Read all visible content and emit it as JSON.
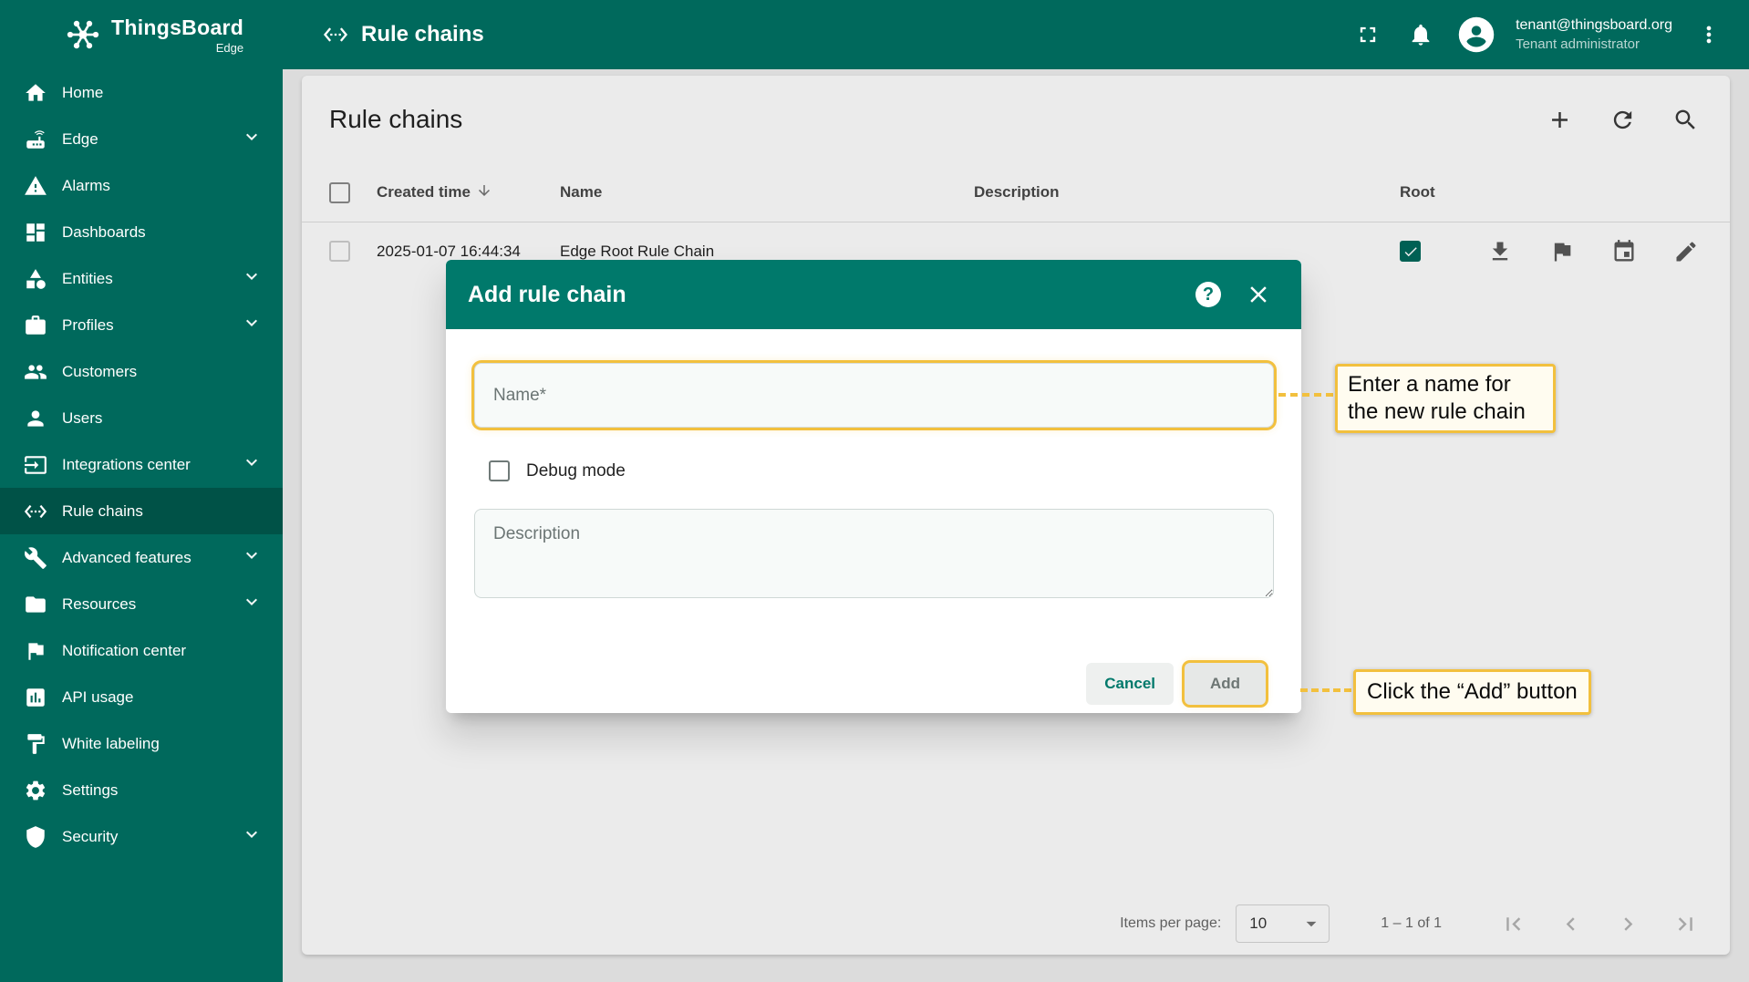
{
  "app": {
    "brand": "ThingsBoard",
    "brand_sub": "Edge"
  },
  "header": {
    "title": "Rule chains",
    "user_email": "tenant@thingsboard.org",
    "user_role": "Tenant administrator"
  },
  "sidebar": {
    "items": [
      {
        "label": "Home",
        "icon": "home",
        "expandable": false,
        "selected": false
      },
      {
        "label": "Edge",
        "icon": "router",
        "expandable": true,
        "selected": false
      },
      {
        "label": "Alarms",
        "icon": "warning",
        "expandable": false,
        "selected": false
      },
      {
        "label": "Dashboards",
        "icon": "dashboards",
        "expandable": false,
        "selected": false
      },
      {
        "label": "Entities",
        "icon": "category",
        "expandable": true,
        "selected": false
      },
      {
        "label": "Profiles",
        "icon": "briefcase",
        "expandable": true,
        "selected": false
      },
      {
        "label": "Customers",
        "icon": "people",
        "expandable": false,
        "selected": false
      },
      {
        "label": "Users",
        "icon": "person",
        "expandable": false,
        "selected": false
      },
      {
        "label": "Integrations center",
        "icon": "input",
        "expandable": true,
        "selected": false
      },
      {
        "label": "Rule chains",
        "icon": "rule-chains",
        "expandable": false,
        "selected": true
      },
      {
        "label": "Advanced features",
        "icon": "wrench",
        "expandable": true,
        "selected": false
      },
      {
        "label": "Resources",
        "icon": "folder",
        "expandable": true,
        "selected": false
      },
      {
        "label": "Notification center",
        "icon": "flag",
        "expandable": false,
        "selected": false
      },
      {
        "label": "API usage",
        "icon": "chart",
        "expandable": false,
        "selected": false
      },
      {
        "label": "White labeling",
        "icon": "paint",
        "expandable": false,
        "selected": false
      },
      {
        "label": "Settings",
        "icon": "gear",
        "expandable": false,
        "selected": false
      },
      {
        "label": "Security",
        "icon": "shield",
        "expandable": true,
        "selected": false
      }
    ]
  },
  "page": {
    "title": "Rule chains",
    "table": {
      "columns": [
        "Created time",
        "Name",
        "Description",
        "Root"
      ],
      "rows": [
        {
          "created_time": "2025-01-07 16:44:34",
          "name": "Edge Root Rule Chain",
          "description": "",
          "root": true
        }
      ]
    },
    "pagination": {
      "items_per_page_label": "Items per page:",
      "items_per_page_value": "10",
      "range": "1 – 1 of 1"
    }
  },
  "dialog": {
    "title": "Add rule chain",
    "name_label": "Name*",
    "debug_label": "Debug mode",
    "description_label": "Description",
    "cancel_label": "Cancel",
    "add_label": "Add"
  },
  "annotations": {
    "name_hint": "Enter a name for the new rule chain",
    "add_hint": "Click the “Add” button"
  },
  "colors": {
    "primary_teal": "#00695c",
    "dialog_teal": "#00796b",
    "annotation_gold": "#f2c03e"
  }
}
